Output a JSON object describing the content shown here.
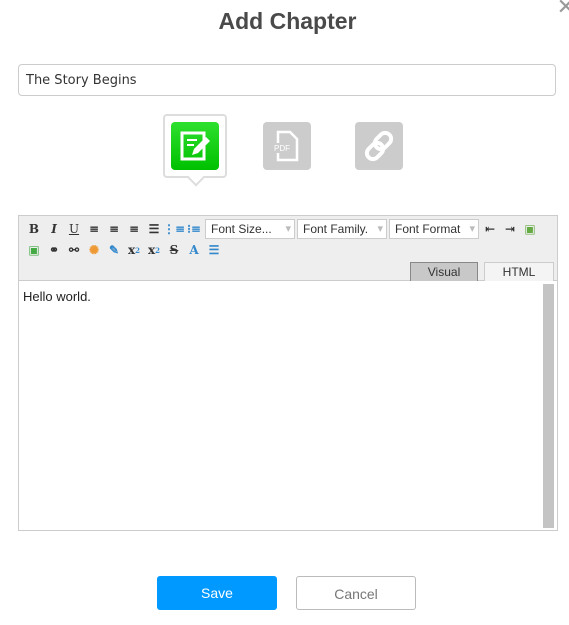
{
  "dialog": {
    "title": "Add Chapter",
    "close_icon": "close-icon"
  },
  "chapter_name": {
    "value": "The Story Begins"
  },
  "types": [
    {
      "name": "text",
      "icon": "edit-document-icon",
      "selected": true,
      "color": "#14c814"
    },
    {
      "name": "pdf",
      "icon": "pdf-icon",
      "label": "PDF",
      "color": "#cccccc"
    },
    {
      "name": "link",
      "icon": "link-icon",
      "color": "#cccccc"
    }
  ],
  "toolbar": {
    "font_size": "Font Size...",
    "font_family": "Font Family.",
    "font_format": "Font Format"
  },
  "tabs": {
    "visual": "Visual",
    "html": "HTML",
    "active": "Visual"
  },
  "content": "Hello world.",
  "buttons": {
    "save": "Save",
    "cancel": "Cancel",
    "save_color": "#0099ff"
  }
}
